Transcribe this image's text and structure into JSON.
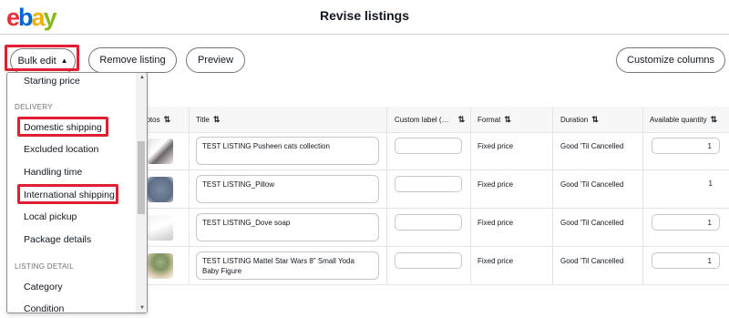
{
  "header": {
    "logo": {
      "e": "e",
      "b": "b",
      "a": "a",
      "y": "y"
    },
    "title": "Revise listings"
  },
  "toolbar": {
    "bulk_edit": "Bulk edit",
    "remove_listing": "Remove listing",
    "preview": "Preview",
    "customize_columns": "Customize columns"
  },
  "colors": {
    "logo_e": "#e53238",
    "logo_b": "#0064d2",
    "logo_a": "#f5af02",
    "logo_y": "#86b817",
    "highlight": "#e02031"
  },
  "table": {
    "columns": [
      "hotos",
      "Title",
      "Custom label (…",
      "Format",
      "Duration",
      "Available quantity"
    ],
    "rows": [
      {
        "title": "TEST LISTING Pusheen cats collection",
        "format": "Fixed price",
        "duration": "Good 'Til Cancelled",
        "quantity": "1"
      },
      {
        "title": "TEST LISTING_Pillow",
        "format": "Fixed price",
        "duration": "Good 'Til Cancelled",
        "quantity": "1"
      },
      {
        "title": "TEST LISTING_Dove soap",
        "format": "Fixed price",
        "duration": "Good 'Til Cancelled",
        "quantity": "1"
      },
      {
        "title": "TEST LISTING Mattel Star Wars 8\" Small Yoda Baby Figure",
        "format": "Fixed price",
        "duration": "Good 'Til Cancelled",
        "quantity": "1"
      }
    ]
  },
  "bulk_menu": {
    "items": [
      {
        "label": "Starting price"
      },
      {
        "section": "DELIVERY"
      },
      {
        "label": "Domestic shipping"
      },
      {
        "label": "Excluded location"
      },
      {
        "label": "Handling time"
      },
      {
        "label": "International shipping"
      },
      {
        "label": "Local pickup"
      },
      {
        "label": "Package details"
      },
      {
        "section": "LISTING DETAIL"
      },
      {
        "label": "Category"
      },
      {
        "label": "Condition"
      }
    ]
  }
}
